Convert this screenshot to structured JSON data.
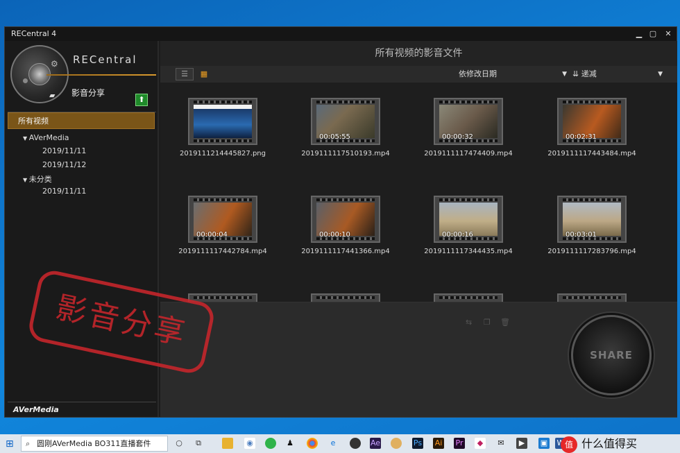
{
  "window": {
    "title": "RECentral 4",
    "minimize": "▁",
    "maximize": "▢",
    "close": "✕"
  },
  "sidebar": {
    "logo_text": "RECentral",
    "section_title": "影音分享",
    "items": [
      {
        "label": "所有视频"
      },
      {
        "label": "AVerMedia"
      },
      {
        "label": "2019/11/11"
      },
      {
        "label": "2019/11/12"
      },
      {
        "label": "未分类"
      },
      {
        "label": "2019/11/11"
      }
    ],
    "footer_logo": "AVerMedia"
  },
  "main": {
    "title": "所有视频的影音文件",
    "sort_field": "依修改日期",
    "sort_order": "递减",
    "files": [
      {
        "name": "2019111214445827.png",
        "duration": "",
        "kind": "image"
      },
      {
        "name": "2019111117510193.mp4",
        "duration": "00:05:55",
        "kind": "video"
      },
      {
        "name": "2019111117474409.mp4",
        "duration": "00:00:32",
        "kind": "video"
      },
      {
        "name": "2019111117443484.mp4",
        "duration": "00:02:31",
        "kind": "video"
      },
      {
        "name": "2019111117442784.mp4",
        "duration": "00:00:04",
        "kind": "video"
      },
      {
        "name": "2019111117441366.mp4",
        "duration": "00:00:10",
        "kind": "video"
      },
      {
        "name": "2019111117344435.mp4",
        "duration": "00:00:16",
        "kind": "video"
      },
      {
        "name": "2019111117283796.mp4",
        "duration": "00:03:01",
        "kind": "video"
      }
    ],
    "share_button": "SHARE"
  },
  "overlay": {
    "stamp_text": "影音分享"
  },
  "taskbar": {
    "search_text": "圆刚AVerMedia BO311直播套件",
    "apps": [
      "Ae",
      "Ps",
      "Ai",
      "Pr"
    ],
    "watermark_text": "什么值得买",
    "watermark_icon": "值"
  },
  "colors": {
    "accent": "#7a5518",
    "stamp": "#c9262c",
    "desktop": "#0b64b8"
  }
}
